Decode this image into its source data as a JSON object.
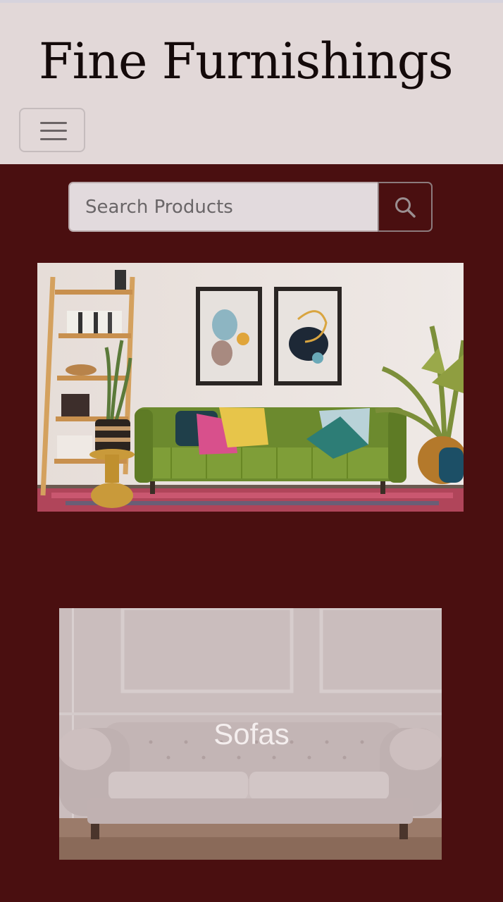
{
  "header": {
    "brand": "Fine Furnishings",
    "menu_icon": "hamburger-menu-icon"
  },
  "search": {
    "placeholder": "Search Products",
    "value": "",
    "button_icon": "search-icon"
  },
  "category_card": {
    "title": "Sofas"
  },
  "colors": {
    "header_bg": "#e2d8d8",
    "page_bg": "#4a0f10",
    "brand_text": "#140a0a"
  }
}
